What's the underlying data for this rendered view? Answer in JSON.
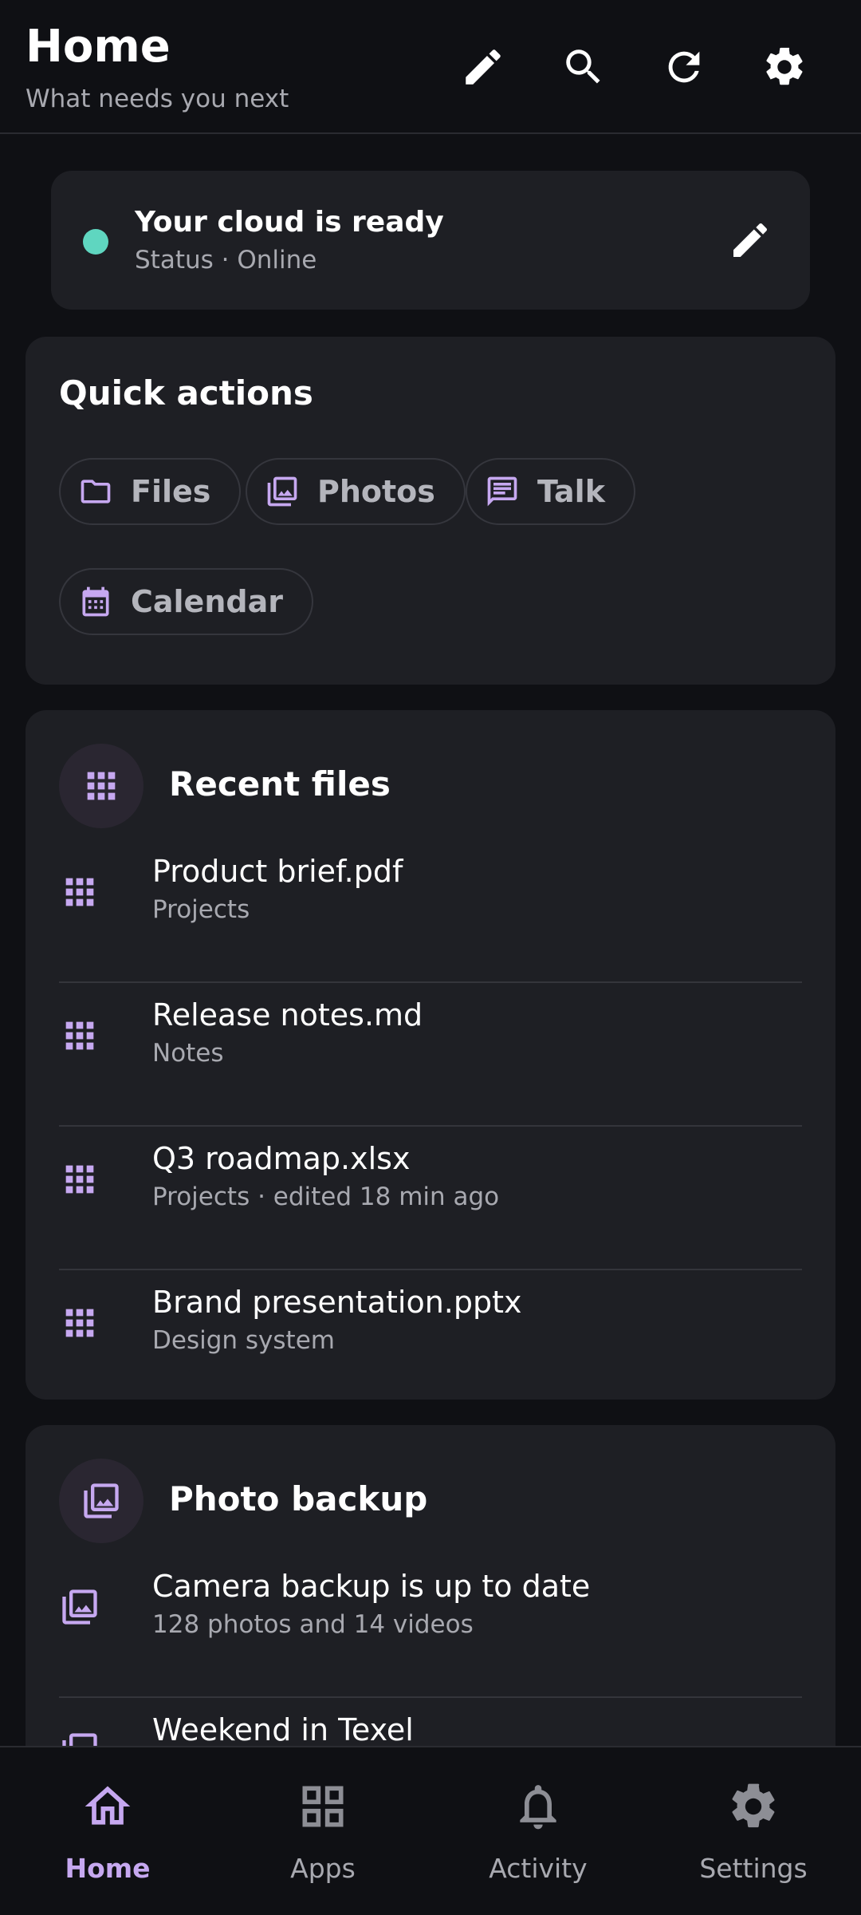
{
  "header": {
    "title": "Home",
    "subtitle": "What needs you next",
    "actions": [
      "edit-icon",
      "search-icon",
      "refresh-icon",
      "settings-icon"
    ]
  },
  "status_card": {
    "title": "Your cloud is ready",
    "subtitle": "Status · Online",
    "dot_color": "#5fd6c0"
  },
  "quick_actions": {
    "title": "Quick actions",
    "chips": [
      {
        "label": "Files",
        "icon": "folder-icon"
      },
      {
        "label": "Photos",
        "icon": "photos-icon"
      },
      {
        "label": "Talk",
        "icon": "chat-icon"
      },
      {
        "label": "Calendar",
        "icon": "calendar-icon"
      }
    ]
  },
  "recent_files": {
    "title": "Recent files",
    "items": [
      {
        "name": "Product brief.pdf",
        "meta": "Projects"
      },
      {
        "name": "Release notes.md",
        "meta": "Notes"
      },
      {
        "name": "Q3 roadmap.xlsx",
        "meta": "Projects · edited 18 min ago"
      },
      {
        "name": "Brand presentation.pptx",
        "meta": "Design system"
      }
    ]
  },
  "photo_backup": {
    "title": "Photo backup",
    "items": [
      {
        "name": "Camera backup is up to date",
        "meta": "128 photos and 14 videos"
      },
      {
        "name": "Weekend in Texel",
        "meta": ""
      }
    ]
  },
  "bottom_nav": {
    "items": [
      {
        "label": "Home",
        "icon": "home-icon",
        "active": true
      },
      {
        "label": "Apps",
        "icon": "apps-grid-icon",
        "active": false
      },
      {
        "label": "Activity",
        "icon": "bell-icon",
        "active": false
      },
      {
        "label": "Settings",
        "icon": "settings-icon",
        "active": false
      }
    ]
  },
  "colors": {
    "background": "#0f1014",
    "card": "#1e1f24",
    "accent": "#c6a8f0",
    "status_online": "#5fd6c0"
  }
}
